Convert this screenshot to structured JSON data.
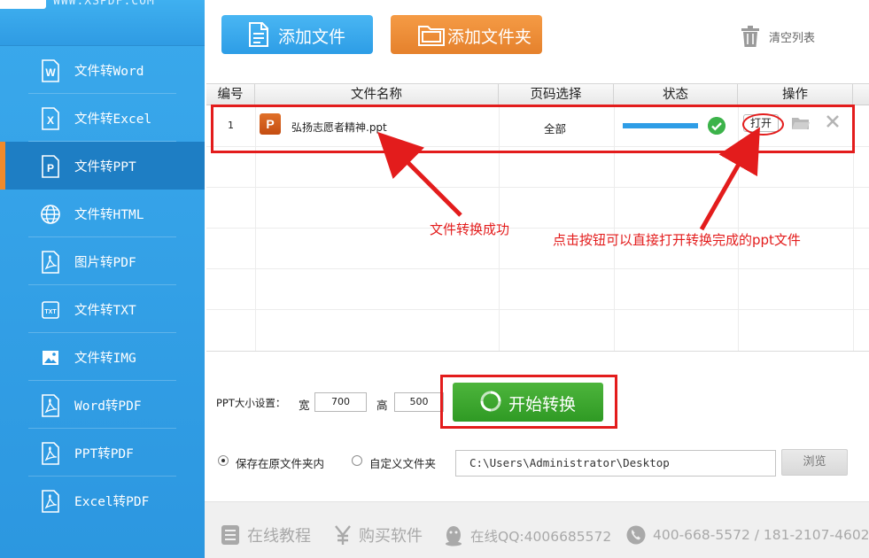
{
  "brand": {
    "site_text": "WWW.XSPDF.COM"
  },
  "sidebar": {
    "items": [
      {
        "label": "文件转Word",
        "icon": "word-icon",
        "active": false
      },
      {
        "label": "文件转Excel",
        "icon": "excel-icon",
        "active": false
      },
      {
        "label": "文件转PPT",
        "icon": "ppt-icon",
        "active": true
      },
      {
        "label": "文件转HTML",
        "icon": "globe-icon",
        "active": false
      },
      {
        "label": "图片转PDF",
        "icon": "pdf-icon",
        "active": false
      },
      {
        "label": "文件转TXT",
        "icon": "txt-icon",
        "active": false
      },
      {
        "label": "文件转IMG",
        "icon": "image-icon",
        "active": false
      },
      {
        "label": "Word转PDF",
        "icon": "pdf-icon",
        "active": false
      },
      {
        "label": "PPT转PDF",
        "icon": "pdf-icon",
        "active": false
      },
      {
        "label": "Excel转PDF",
        "icon": "pdf-icon",
        "active": false
      }
    ]
  },
  "toolbar": {
    "add_file": "添加文件",
    "add_folder": "添加文件夹",
    "clear_list": "清空列表"
  },
  "table": {
    "columns": [
      "编号",
      "文件名称",
      "页码选择",
      "状态",
      "操作"
    ],
    "rows": [
      {
        "index": "1",
        "file_name": "弘扬志愿者精神.ppt",
        "pages": "全部",
        "progress": 1.0,
        "status_icon": "check-icon",
        "open_label": "打开"
      }
    ]
  },
  "annotations": {
    "success": "文件转换成功",
    "open_hint": "点击按钮可以直接打开转换完成的ppt文件"
  },
  "settings": {
    "size_label": "PPT大小设置：",
    "width_label": "宽",
    "width_value": "700",
    "height_label": "高",
    "height_value": "500",
    "start_label": "开始转换",
    "save_original_label": "保存在原文件夹内",
    "custom_folder_label": "自定义文件夹",
    "save_mode": "original",
    "path_value": "C:\\Users\\Administrator\\Desktop",
    "browse_label": "浏览"
  },
  "footer": {
    "tutorial": "在线教程",
    "buy": "购买软件",
    "qq": "在线QQ:4006685572",
    "phone": "400-668-5572 / 181-2107-4602"
  },
  "colors": {
    "sidebar_blue": "#2c97e0",
    "active_accent": "#f08a2b",
    "add_file_blue": "#2d9de6",
    "add_folder_orange": "#e5812c",
    "start_green": "#2f9a24",
    "annotation_red": "#e31c1c"
  }
}
